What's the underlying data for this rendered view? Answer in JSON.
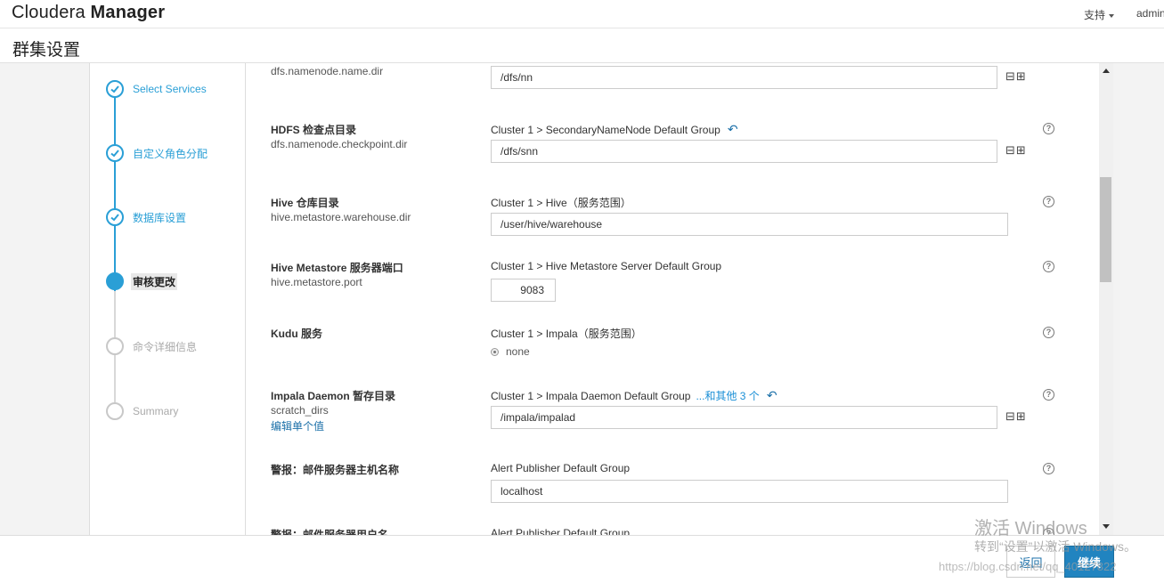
{
  "app": {
    "brand_light": "Cloudera",
    "brand_bold": "Manager",
    "nav_support": "支持",
    "nav_admin": "admin"
  },
  "page_title": "群集设置",
  "wizard": {
    "steps": [
      {
        "label": "Select Services",
        "state": "done"
      },
      {
        "label": "自定义角色分配",
        "state": "done"
      },
      {
        "label": "数据库设置",
        "state": "done"
      },
      {
        "label": "审核更改",
        "state": "active"
      },
      {
        "label": "命令详细信息",
        "state": "pending"
      },
      {
        "label": "Summary",
        "state": "pending"
      }
    ]
  },
  "settings": [
    {
      "title": "",
      "key": "dfs.namenode.name.dir",
      "scope": "",
      "value": "/dfs/nn"
    },
    {
      "title": "HDFS 检查点目录",
      "key": "dfs.namenode.checkpoint.dir",
      "scope": "Cluster 1 > SecondaryNameNode Default Group",
      "value": "/dfs/snn"
    },
    {
      "title": "Hive 仓库目录",
      "key": "hive.metastore.warehouse.dir",
      "scope": "Cluster 1 > Hive（服务范围）",
      "value": "/user/hive/warehouse"
    },
    {
      "title": "Hive Metastore 服务器端口",
      "key": "hive.metastore.port",
      "scope": "Cluster 1 > Hive Metastore Server Default Group",
      "value": "9083"
    },
    {
      "title": "Kudu 服务",
      "key": "",
      "scope": "Cluster 1 > Impala（服务范围）",
      "option": "none"
    },
    {
      "title": "Impala Daemon 暂存目录",
      "key": "scratch_dirs",
      "link": "编辑单个值",
      "scope": "Cluster 1 > Impala Daemon Default Group",
      "scope_more": "...和其他 3 个",
      "value": "/impala/impalad"
    },
    {
      "title": "警报：邮件服务器主机名称",
      "key": "",
      "scope": "Alert Publisher Default Group",
      "value": "localhost"
    },
    {
      "title": "警报：邮件服务器用户名",
      "key": "",
      "scope": "Alert Publisher Default Group"
    }
  ],
  "footer": {
    "back_label": "返回",
    "next_label": "继续"
  },
  "watermark": {
    "line1": "激活 Windows",
    "line2": "转到“设置”以激活 Windows。",
    "line3": "https://blog.csdn.net/qq_40127822"
  },
  "colors": {
    "accent": "#2a9fd6",
    "primary_button": "#2184c0",
    "link": "#1a6fa8"
  }
}
